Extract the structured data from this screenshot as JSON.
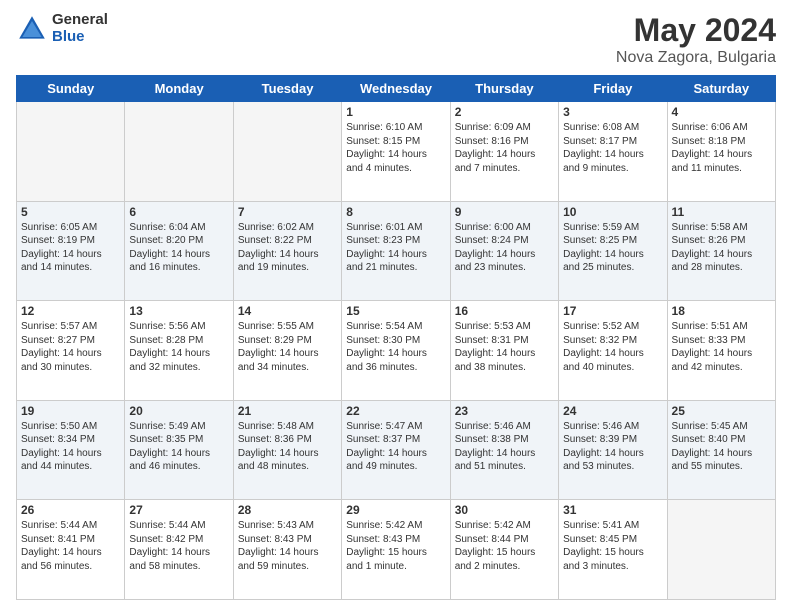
{
  "header": {
    "logo_general": "General",
    "logo_blue": "Blue",
    "title": "May 2024",
    "subtitle": "Nova Zagora, Bulgaria"
  },
  "days_of_week": [
    "Sunday",
    "Monday",
    "Tuesday",
    "Wednesday",
    "Thursday",
    "Friday",
    "Saturday"
  ],
  "weeks": [
    [
      {
        "day": "",
        "content": ""
      },
      {
        "day": "",
        "content": ""
      },
      {
        "day": "",
        "content": ""
      },
      {
        "day": "1",
        "content": "Sunrise: 6:10 AM\nSunset: 8:15 PM\nDaylight: 14 hours\nand 4 minutes."
      },
      {
        "day": "2",
        "content": "Sunrise: 6:09 AM\nSunset: 8:16 PM\nDaylight: 14 hours\nand 7 minutes."
      },
      {
        "day": "3",
        "content": "Sunrise: 6:08 AM\nSunset: 8:17 PM\nDaylight: 14 hours\nand 9 minutes."
      },
      {
        "day": "4",
        "content": "Sunrise: 6:06 AM\nSunset: 8:18 PM\nDaylight: 14 hours\nand 11 minutes."
      }
    ],
    [
      {
        "day": "5",
        "content": "Sunrise: 6:05 AM\nSunset: 8:19 PM\nDaylight: 14 hours\nand 14 minutes."
      },
      {
        "day": "6",
        "content": "Sunrise: 6:04 AM\nSunset: 8:20 PM\nDaylight: 14 hours\nand 16 minutes."
      },
      {
        "day": "7",
        "content": "Sunrise: 6:02 AM\nSunset: 8:22 PM\nDaylight: 14 hours\nand 19 minutes."
      },
      {
        "day": "8",
        "content": "Sunrise: 6:01 AM\nSunset: 8:23 PM\nDaylight: 14 hours\nand 21 minutes."
      },
      {
        "day": "9",
        "content": "Sunrise: 6:00 AM\nSunset: 8:24 PM\nDaylight: 14 hours\nand 23 minutes."
      },
      {
        "day": "10",
        "content": "Sunrise: 5:59 AM\nSunset: 8:25 PM\nDaylight: 14 hours\nand 25 minutes."
      },
      {
        "day": "11",
        "content": "Sunrise: 5:58 AM\nSunset: 8:26 PM\nDaylight: 14 hours\nand 28 minutes."
      }
    ],
    [
      {
        "day": "12",
        "content": "Sunrise: 5:57 AM\nSunset: 8:27 PM\nDaylight: 14 hours\nand 30 minutes."
      },
      {
        "day": "13",
        "content": "Sunrise: 5:56 AM\nSunset: 8:28 PM\nDaylight: 14 hours\nand 32 minutes."
      },
      {
        "day": "14",
        "content": "Sunrise: 5:55 AM\nSunset: 8:29 PM\nDaylight: 14 hours\nand 34 minutes."
      },
      {
        "day": "15",
        "content": "Sunrise: 5:54 AM\nSunset: 8:30 PM\nDaylight: 14 hours\nand 36 minutes."
      },
      {
        "day": "16",
        "content": "Sunrise: 5:53 AM\nSunset: 8:31 PM\nDaylight: 14 hours\nand 38 minutes."
      },
      {
        "day": "17",
        "content": "Sunrise: 5:52 AM\nSunset: 8:32 PM\nDaylight: 14 hours\nand 40 minutes."
      },
      {
        "day": "18",
        "content": "Sunrise: 5:51 AM\nSunset: 8:33 PM\nDaylight: 14 hours\nand 42 minutes."
      }
    ],
    [
      {
        "day": "19",
        "content": "Sunrise: 5:50 AM\nSunset: 8:34 PM\nDaylight: 14 hours\nand 44 minutes."
      },
      {
        "day": "20",
        "content": "Sunrise: 5:49 AM\nSunset: 8:35 PM\nDaylight: 14 hours\nand 46 minutes."
      },
      {
        "day": "21",
        "content": "Sunrise: 5:48 AM\nSunset: 8:36 PM\nDaylight: 14 hours\nand 48 minutes."
      },
      {
        "day": "22",
        "content": "Sunrise: 5:47 AM\nSunset: 8:37 PM\nDaylight: 14 hours\nand 49 minutes."
      },
      {
        "day": "23",
        "content": "Sunrise: 5:46 AM\nSunset: 8:38 PM\nDaylight: 14 hours\nand 51 minutes."
      },
      {
        "day": "24",
        "content": "Sunrise: 5:46 AM\nSunset: 8:39 PM\nDaylight: 14 hours\nand 53 minutes."
      },
      {
        "day": "25",
        "content": "Sunrise: 5:45 AM\nSunset: 8:40 PM\nDaylight: 14 hours\nand 55 minutes."
      }
    ],
    [
      {
        "day": "26",
        "content": "Sunrise: 5:44 AM\nSunset: 8:41 PM\nDaylight: 14 hours\nand 56 minutes."
      },
      {
        "day": "27",
        "content": "Sunrise: 5:44 AM\nSunset: 8:42 PM\nDaylight: 14 hours\nand 58 minutes."
      },
      {
        "day": "28",
        "content": "Sunrise: 5:43 AM\nSunset: 8:43 PM\nDaylight: 14 hours\nand 59 minutes."
      },
      {
        "day": "29",
        "content": "Sunrise: 5:42 AM\nSunset: 8:43 PM\nDaylight: 15 hours\nand 1 minute."
      },
      {
        "day": "30",
        "content": "Sunrise: 5:42 AM\nSunset: 8:44 PM\nDaylight: 15 hours\nand 2 minutes."
      },
      {
        "day": "31",
        "content": "Sunrise: 5:41 AM\nSunset: 8:45 PM\nDaylight: 15 hours\nand 3 minutes."
      },
      {
        "day": "",
        "content": ""
      }
    ]
  ]
}
